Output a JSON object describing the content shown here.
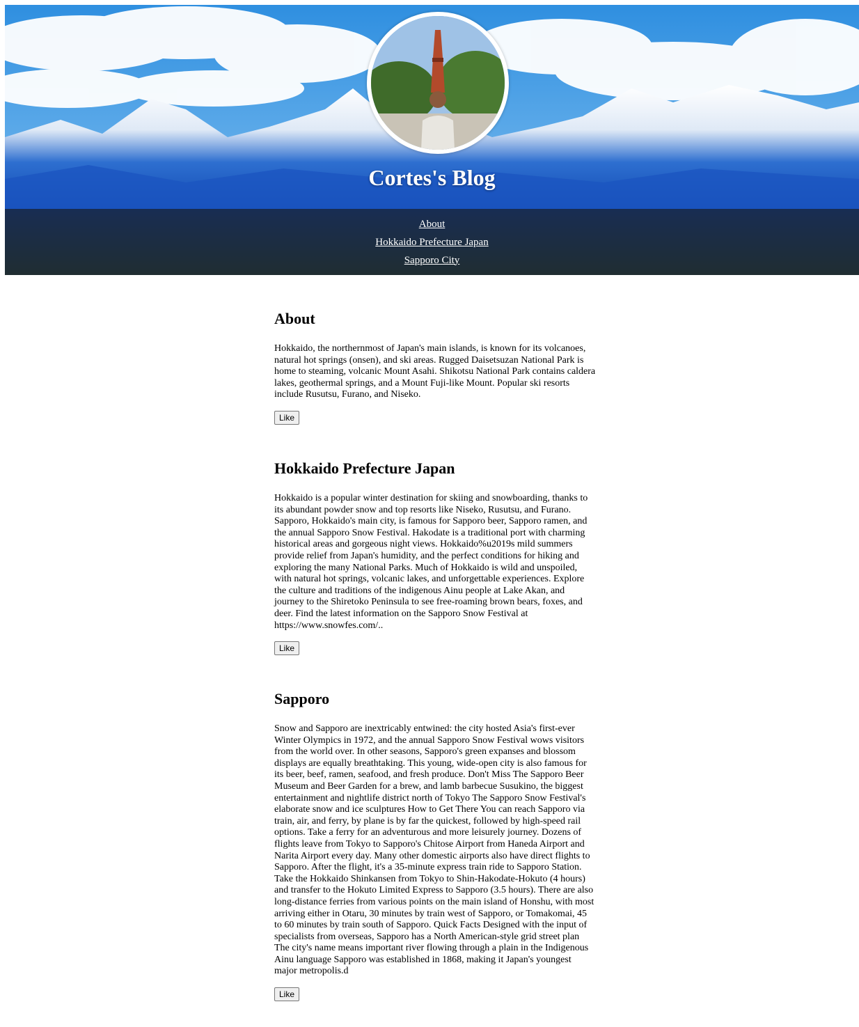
{
  "header": {
    "title": "Cortes's Blog",
    "avatar_icon": "profile-photo",
    "nav": [
      {
        "label": "About"
      },
      {
        "label": "Hokkaido Prefecture Japan"
      },
      {
        "label": "Sapporo City"
      }
    ]
  },
  "posts": [
    {
      "title": "About",
      "body": "Hokkaido, the northernmost of Japan's main islands, is known for its volcanoes, natural hot springs (onsen), and ski areas. Rugged Daisetsuzan National Park is home to steaming, volcanic Mount Asahi. Shikotsu National Park contains caldera lakes, geothermal springs, and a Mount Fuji-like Mount. Popular ski resorts include Rusutsu, Furano, and Niseko.",
      "like_label": "Like"
    },
    {
      "title": "Hokkaido Prefecture Japan",
      "body": "Hokkaido is a popular winter destination for skiing and snowboarding, thanks to its abundant powder snow and top resorts like Niseko, Rusutsu, and Furano. Sapporo, Hokkaido's main city, is famous for Sapporo beer, Sapporo ramen, and the annual Sapporo Snow Festival. Hakodate is a traditional port with charming historical areas and gorgeous night views. Hokkaido%u2019s mild summers provide relief from Japan's humidity, and the perfect conditions for hiking and exploring the many National Parks. Much of Hokkaido is wild and unspoiled, with natural hot springs, volcanic lakes, and unforgettable experiences. Explore the culture and traditions of the indigenous Ainu people at Lake Akan, and journey to the Shiretoko Peninsula to see free-roaming brown bears, foxes, and deer. Find the latest information on the Sapporo Snow Festival at https://www.snowfes.com/..",
      "like_label": "Like"
    },
    {
      "title": "Sapporo",
      "body": "Snow and Sapporo are inextricably entwined: the city hosted Asia's first-ever Winter Olympics in 1972, and the annual Sapporo Snow Festival wows visitors from the world over. In other seasons, Sapporo's green expanses and blossom displays are equally breathtaking. This young, wide-open city is also famous for its beer, beef, ramen, seafood, and fresh produce. Don't Miss The Sapporo Beer Museum and Beer Garden for a brew, and lamb barbecue Susukino, the biggest entertainment and nightlife district north of Tokyo The Sapporo Snow Festival's elaborate snow and ice sculptures How to Get There You can reach Sapporo via train, air, and ferry, by plane is by far the quickest, followed by high-speed rail options. Take a ferry for an adventurous and more leisurely journey. Dozens of flights leave from Tokyo to Sapporo's Chitose Airport from Haneda Airport and Narita Airport every day. Many other domestic airports also have direct flights to Sapporo. After the flight, it's a 35-minute express train ride to Sapporo Station. Take the Hokkaido Shinkansen from Tokyo to Shin-Hakodate-Hokuto (4 hours) and transfer to the Hokuto Limited Express to Sapporo (3.5 hours). There are also long-distance ferries from various points on the main island of Honshu, with most arriving either in Otaru, 30 minutes by train west of Sapporo, or Tomakomai, 45 to 60 minutes by train south of Sapporo. Quick Facts Designed with the input of specialists from overseas, Sapporo has a North American-style grid street plan The city's name means important river flowing through a plain in the Indigenous Ainu language Sapporo was established in 1868, making it Japan's youngest major metropolis.d",
      "like_label": "Like"
    }
  ]
}
